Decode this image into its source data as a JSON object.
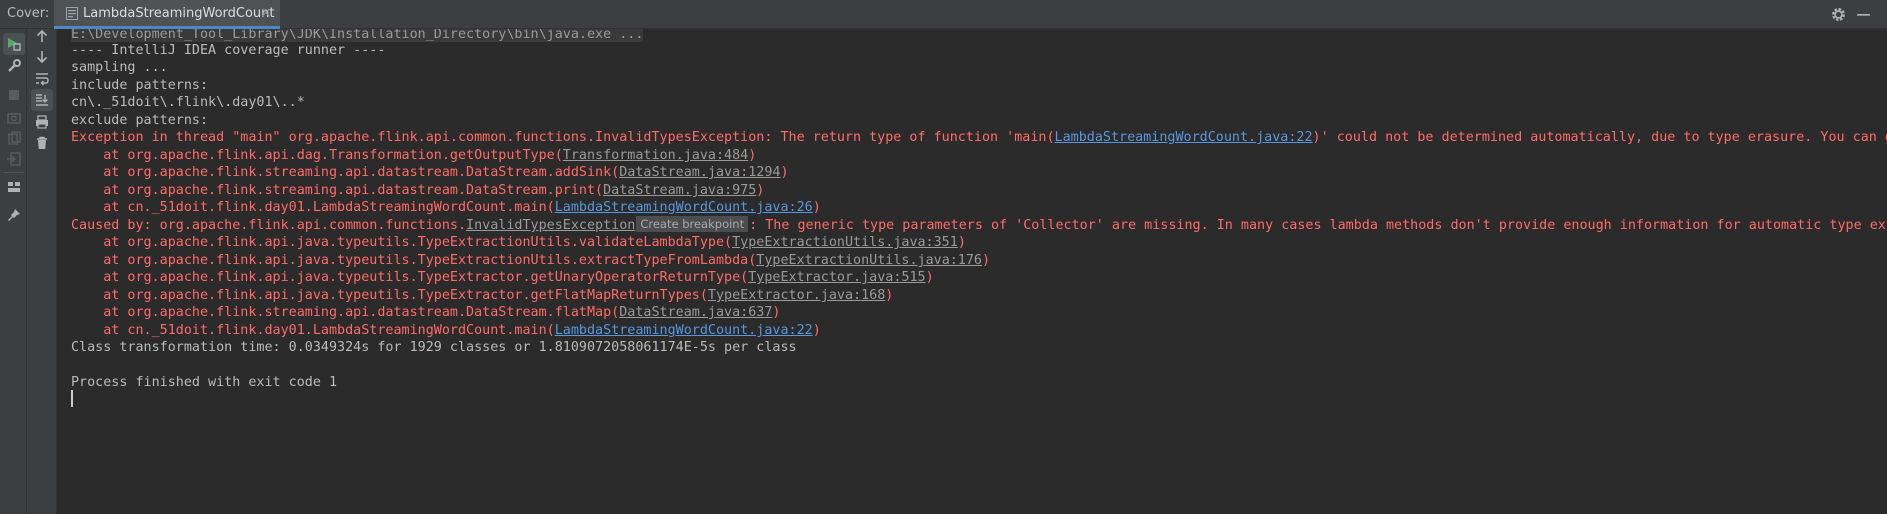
{
  "window": {
    "cover_label": "Cover:",
    "tab_title": "LambdaStreamingWordCount",
    "tab_close": "×"
  },
  "toolbar": {
    "left_icons": [
      "coverage-run-icon",
      "wrench-icon",
      "stop-icon",
      "camera-icon",
      "export-icon",
      "login-icon",
      "layout-icon",
      "pin-icon"
    ],
    "right_icons": [
      "up-arrow-icon",
      "down-arrow-icon",
      "soft-wrap-icon",
      "scroll-to-end-icon",
      "print-icon",
      "trash-icon"
    ]
  },
  "console": {
    "cmd": "E:\\Development_Tool_Library\\JDK\\Installation_Directory\\bin\\java.exe ...",
    "l1": "---- IntelliJ IDEA coverage runner ----",
    "l2": "sampling ...",
    "l3": "include patterns:",
    "l4": "cn\\._51doit\\.flink\\.day01\\..*",
    "l5": "exclude patterns:",
    "exc_prefix": "Exception in thread \"main\" org.apache.flink.api.common.functions.InvalidTypesException: The return type of function 'main(",
    "exc_link": "LambdaStreamingWordCount.java:22",
    "exc_suffix": ")' could not be determined automatically, due to type erasure. You can give type information hints by using the returns(...) method",
    "s1_pre": "    at org.apache.flink.api.dag.Transformation.getOutputType(",
    "s1_link": "Transformation.java:484",
    "s2_pre": "    at org.apache.flink.streaming.api.datastream.DataStream.addSink(",
    "s2_link": "DataStream.java:1294",
    "s3_pre": "    at org.apache.flink.streaming.api.datastream.DataStream.print(",
    "s3_link": "DataStream.java:975",
    "s4_pre": "    at cn._51doit.flink.day01.LambdaStreamingWordCount.main(",
    "s4_link": "LambdaStreamingWordCount.java:26",
    "cause_pre": "Caused by: org.apache.flink.api.common.functions.",
    "cause_link": "InvalidTypesException",
    "create_bp": "Create breakpoint",
    "cause_suffix": ": The generic type parameters of 'Collector' are missing. In many cases lambda methods don't provide enough information for automatic type extraction",
    "c1_pre": "    at org.apache.flink.api.java.typeutils.TypeExtractionUtils.validateLambdaType(",
    "c1_link": "TypeExtractionUtils.java:351",
    "c2_pre": "    at org.apache.flink.api.java.typeutils.TypeExtractionUtils.extractTypeFromLambda(",
    "c2_link": "TypeExtractionUtils.java:176",
    "c3_pre": "    at org.apache.flink.api.java.typeutils.TypeExtractor.getUnaryOperatorReturnType(",
    "c3_link": "TypeExtractor.java:515",
    "c4_pre": "    at org.apache.flink.api.java.typeutils.TypeExtractor.getFlatMapReturnTypes(",
    "c4_link": "TypeExtractor.java:168",
    "c5_pre": "    at org.apache.flink.streaming.api.datastream.DataStream.flatMap(",
    "c5_link": "DataStream.java:637",
    "c6_pre": "    at cn._51doit.flink.day01.LambdaStreamingWordCount.main(",
    "c6_link": "LambdaStreamingWordCount.java:22",
    "close_paren": ")",
    "timing": "Class transformation time: 0.0349324s for 1929 classes or 1.8109072058061174E-5s per class",
    "exit": "Process finished with exit code 1"
  }
}
